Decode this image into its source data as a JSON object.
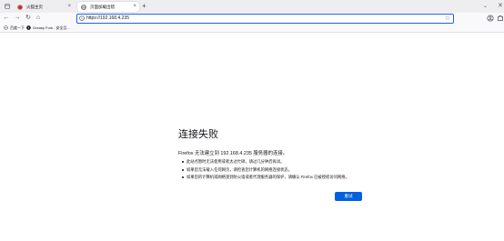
{
  "tabs": [
    {
      "title": "火狐主页",
      "close": "×"
    },
    {
      "title": "页面加载出错",
      "close": "×"
    }
  ],
  "tab_new": "+",
  "tabs_overflow": "⌄",
  "window_close": "✕",
  "nav": {
    "back": "←",
    "forward": "→",
    "reload": "↻",
    "home": "⌂"
  },
  "urlbar": {
    "url": "https://192.168.4.235",
    "star": "☆"
  },
  "bookmarks": [
    {
      "label": "百度一下"
    },
    {
      "label": "Greasy Fork - 安全且..."
    }
  ],
  "error": {
    "title": "连接失败",
    "lead": "Firefox 无法建立到 192.168.4.235 服务器的连接。",
    "bullets": [
      "此站点暂时无法使用或者太过忙碌，请过几分钟后再试。",
      "如果您无法载入任何网页，请检查您计算机的网络连接状态。",
      "如果您的计算机或网络受到防火墙或者代理服务器的保护，请确认 Firefox 已被授权访问网络。"
    ],
    "retry_label": "重试"
  },
  "colors": {
    "accent": "#0061e0",
    "focus_ring": "#1c62ed",
    "chrome": "#eeeef0"
  }
}
